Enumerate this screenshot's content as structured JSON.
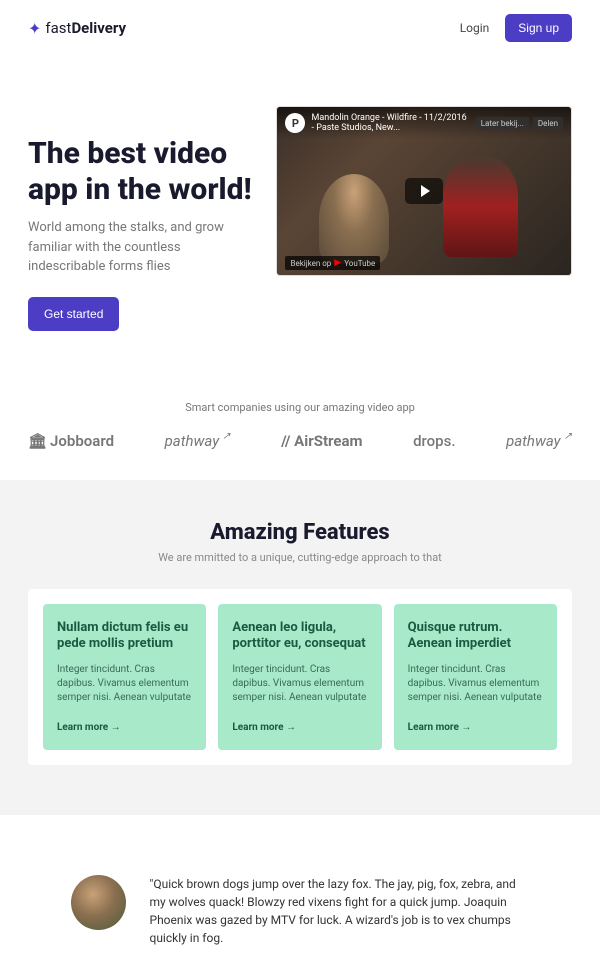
{
  "header": {
    "logo_text": "fast",
    "logo_bold": "Delivery",
    "login": "Login",
    "signup": "Sign up"
  },
  "hero": {
    "title": "The best video app in the world!",
    "subtitle": "World among the stalks, and grow familiar with the countless indescribable forms flies",
    "cta": "Get started",
    "video": {
      "avatar_letter": "P",
      "title": "Mandolin Orange - Wildfire - 11/2/2016 - Paste Studios, New...",
      "later": "Later bekij...",
      "share": "Delen",
      "watch_on": "Bekijken op",
      "platform": "YouTube"
    }
  },
  "companies": {
    "heading": "Smart companies using our amazing video app",
    "jobboard": "Jobboard",
    "pathway": "pathway",
    "airstream": "// AirStream",
    "drops": "drops.",
    "pathway2": "pathway"
  },
  "features": {
    "title": "Amazing Features",
    "subtitle": "We are mmitted to a unique, cutting-edge approach to that",
    "cards": [
      {
        "title": "Nullam dictum felis eu pede mollis pretium",
        "body": "Integer tincidunt. Cras dapibus. Vivamus elementum semper nisi. Aenean vulputate",
        "link": "Learn more →"
      },
      {
        "title": "Aenean leo ligula, porttitor eu, consequat",
        "body": "Integer tincidunt. Cras dapibus. Vivamus elementum semper nisi. Aenean vulputate",
        "link": "Learn more →"
      },
      {
        "title": "Quisque rutrum. Aenean imperdiet",
        "body": "Integer tincidunt. Cras dapibus. Vivamus elementum semper nisi. Aenean vulputate",
        "link": "Learn more →"
      }
    ]
  },
  "testimonial": {
    "quote": "\"Quick brown dogs jump over the lazy fox. The jay, pig, fox, zebra, and my wolves quack! Blowzy red vixens fight for a quick jump. Joaquin Phoenix was gazed by MTV for luck. A wizard's job is to vex chumps quickly in fog."
  }
}
